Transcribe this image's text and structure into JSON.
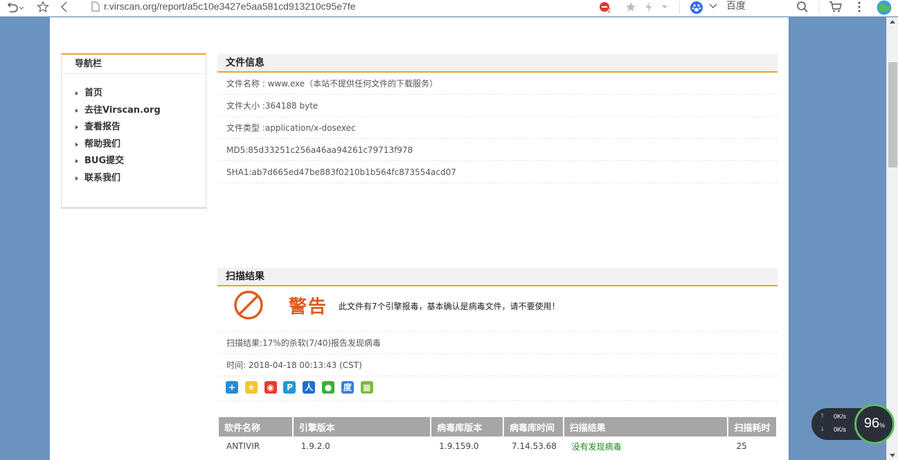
{
  "browser": {
    "url": "r.virscan.org/report/a5c10e3427e5aa581cd913210c95e7fe",
    "search_engine": "百度",
    "blocked_count": "2"
  },
  "nav": {
    "title": "导航栏",
    "items": [
      {
        "label": "首页"
      },
      {
        "label": "去往Virscan.org"
      },
      {
        "label": "查看报告"
      },
      {
        "label": "帮助我们"
      },
      {
        "label": "BUG提交"
      },
      {
        "label": "联系我们"
      }
    ]
  },
  "file_info": {
    "title": "文件信息",
    "name": "文件名称 : www.exe（本站不提供任何文件的下载服务）",
    "size": "文件大小 :364188 byte",
    "type": "文件类型 :application/x-dosexec",
    "md5": "MD5:85d33251c256a46aa94261c79713f978",
    "sha1": "SHA1:ab7d665ed47be883f0210b1b564fc873554acd07"
  },
  "scan": {
    "title": "扫描结果",
    "warning_word": "警告",
    "warning_msg": "此文件有7个引擎报毒，基本确认是病毒文件，请不要使用！",
    "summary": "扫描结果:17%的杀软(7/40)报告发现病毒",
    "time": "时间: 2018-04-18 00:13:43 (CST)",
    "share_icons": [
      "plus-share",
      "qzone",
      "weibo",
      "tencent-weibo",
      "renren",
      "wechat",
      "baidu",
      "image-share"
    ]
  },
  "table": {
    "headers": [
      "软件名称",
      "引擎版本",
      "病毒库版本",
      "病毒库时间",
      "扫描结果",
      "扫描耗时"
    ],
    "rows": [
      [
        "ANTIVIR",
        "1.9.2.0",
        "1.9.159.0",
        "7.14.53.68",
        "没有发现病毒",
        "25"
      ]
    ]
  },
  "net_widget": {
    "up": "0K/s",
    "down": "0K/s",
    "percent": "96",
    "percent_unit": "%"
  },
  "colors": {
    "accent": "#f0a030",
    "warning": "#e05a1a",
    "ok": "#1a8a1a",
    "page_bg": "#6b93bf"
  }
}
